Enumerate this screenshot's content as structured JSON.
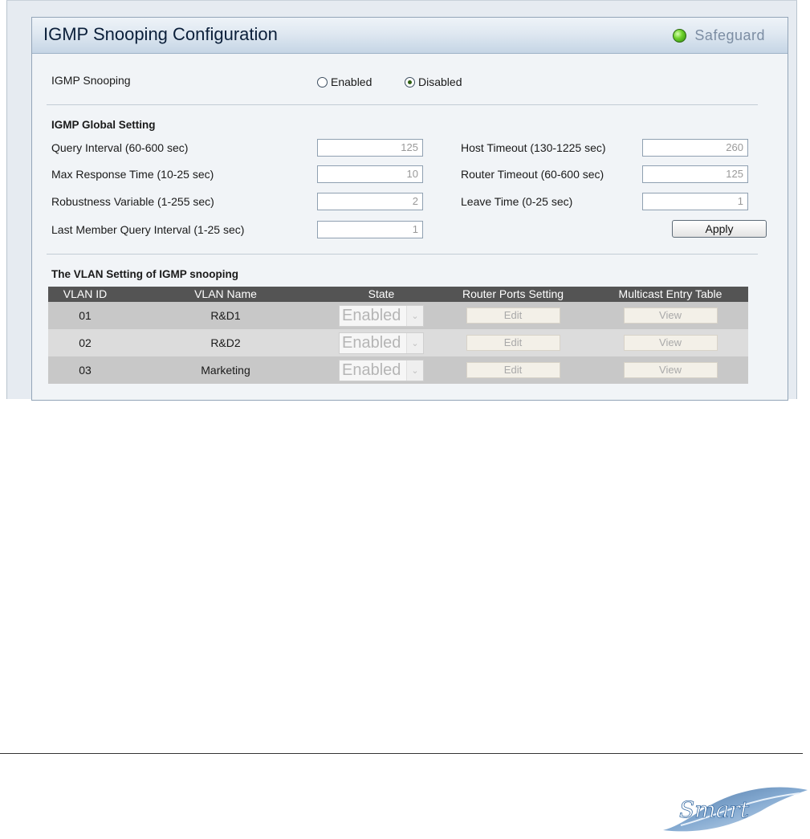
{
  "window": {
    "title": "IGMP Snooping Configuration",
    "safeguard_label": "Safeguard"
  },
  "igmp_snooping": {
    "label": "IGMP Snooping",
    "options": [
      {
        "label": "Enabled",
        "selected": false
      },
      {
        "label": "Disabled",
        "selected": true
      }
    ]
  },
  "global_setting": {
    "heading": "IGMP Global Setting",
    "fields": [
      {
        "label": "Query Interval (60-600 sec)",
        "value": "125"
      },
      {
        "label": "Max Response Time (10-25 sec)",
        "value": "10"
      },
      {
        "label": "Robustness Variable (1-255 sec)",
        "value": "2"
      },
      {
        "label": "Last Member Query Interval (1-25 sec)",
        "value": "1"
      },
      {
        "label": "Host Timeout (130-1225 sec)",
        "value": "260"
      },
      {
        "label": "Router Timeout (60-600 sec)",
        "value": "125"
      },
      {
        "label": "Leave Time (0-25 sec)",
        "value": "1"
      }
    ],
    "apply_label": "Apply"
  },
  "vlan_table": {
    "heading": "The VLAN Setting of IGMP snooping",
    "columns": [
      "VLAN ID",
      "VLAN Name",
      "State",
      "Router Ports Setting",
      "Multicast Entry Table"
    ],
    "rows": [
      {
        "id": "01",
        "name": "R&D1",
        "state": "Enabled",
        "edit": "Edit",
        "view": "View"
      },
      {
        "id": "02",
        "name": "R&D2",
        "state": "Enabled",
        "edit": "Edit",
        "view": "View"
      },
      {
        "id": "03",
        "name": "Marketing",
        "state": "Enabled",
        "edit": "Edit",
        "view": "View"
      }
    ]
  },
  "footer": {
    "logo_text": "Smart"
  },
  "colors": {
    "panel_bg": "#f1f4f7",
    "title_gradient_end": "#c5d5e5",
    "table_header": "#545454",
    "led_green": "#6fd22c"
  }
}
